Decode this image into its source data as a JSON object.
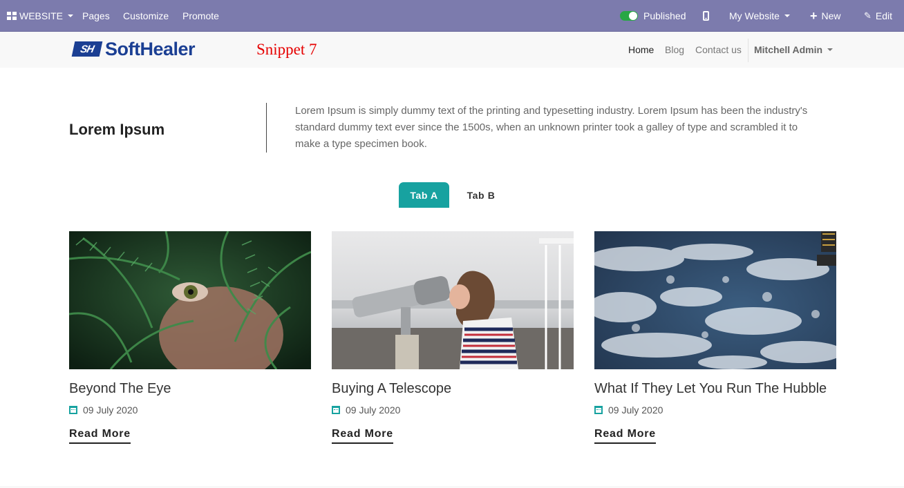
{
  "topbar": {
    "website_label": "WEBSITE",
    "pages_label": "Pages",
    "customize_label": "Customize",
    "promote_label": "Promote",
    "published_label": "Published",
    "my_website_label": "My Website",
    "new_label": "New",
    "edit_label": "Edit",
    "bg_color": "#7c7bad",
    "toggle_color": "#28a745"
  },
  "header": {
    "logo_mark": "SH",
    "logo_text": "SoftHealer",
    "snippet_title": "Snippet 7",
    "nav": {
      "home": "Home",
      "blog": "Blog",
      "contact": "Contact us",
      "user": "Mitchell Admin"
    }
  },
  "intro": {
    "heading": "Lorem Ipsum",
    "text": "Lorem Ipsum is simply dummy text of the printing and typesetting industry. Lorem Ipsum has been the industry's standard dummy text ever since the 1500s, when an unknown printer took a galley of type and scrambled it to make a type specimen book."
  },
  "tabs": [
    {
      "label": "Tab A",
      "active": true
    },
    {
      "label": "Tab B",
      "active": false
    }
  ],
  "accent_color": "#17a2a0",
  "cards": [
    {
      "title": "Beyond The Eye",
      "date": "09 July 2020",
      "read_more": "Read More",
      "image": "fern-eye-photo"
    },
    {
      "title": "Buying A Telescope",
      "date": "09 July 2020",
      "read_more": "Read More",
      "image": "telescope-photo"
    },
    {
      "title": "What If They Let You Run The Hubble",
      "date": "09 July 2020",
      "read_more": "Read More",
      "image": "earth-clouds-photo"
    }
  ]
}
